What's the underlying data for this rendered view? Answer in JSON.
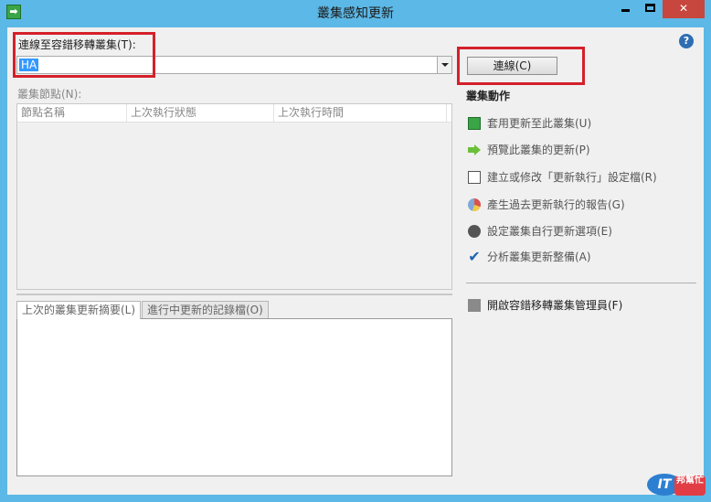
{
  "window": {
    "title": "叢集感知更新"
  },
  "connect": {
    "label": "連線至容錯移轉叢集(T):",
    "value": "HA",
    "button_label": "連線(C)"
  },
  "nodes": {
    "label": "叢集節點(N):",
    "columns": [
      "節點名稱",
      "上次執行狀態",
      "上次執行時間"
    ]
  },
  "tabs": [
    {
      "label": "上次的叢集更新摘要(L)",
      "active": true
    },
    {
      "label": "進行中更新的記錄檔(O)",
      "active": false
    }
  ],
  "actions": {
    "header": "叢集動作",
    "items": [
      {
        "label": "套用更新至此叢集(U)",
        "icon": "apply-updates-icon"
      },
      {
        "label": "預覽此叢集的更新(P)",
        "icon": "preview-arrow-icon"
      },
      {
        "label": "建立或修改「更新執行」設定檔(R)",
        "icon": "document-icon"
      },
      {
        "label": "產生過去更新執行的報告(G)",
        "icon": "report-chart-icon"
      },
      {
        "label": "設定叢集自行更新選項(E)",
        "icon": "gear-icon"
      },
      {
        "label": "分析叢集更新整備(A)",
        "icon": "checkmark-icon"
      }
    ],
    "manager": {
      "label": "開啟容錯移轉叢集管理員(F)",
      "icon": "cluster-manager-icon"
    }
  },
  "watermark": {
    "logo": "IT",
    "text": "邦幫忙"
  }
}
